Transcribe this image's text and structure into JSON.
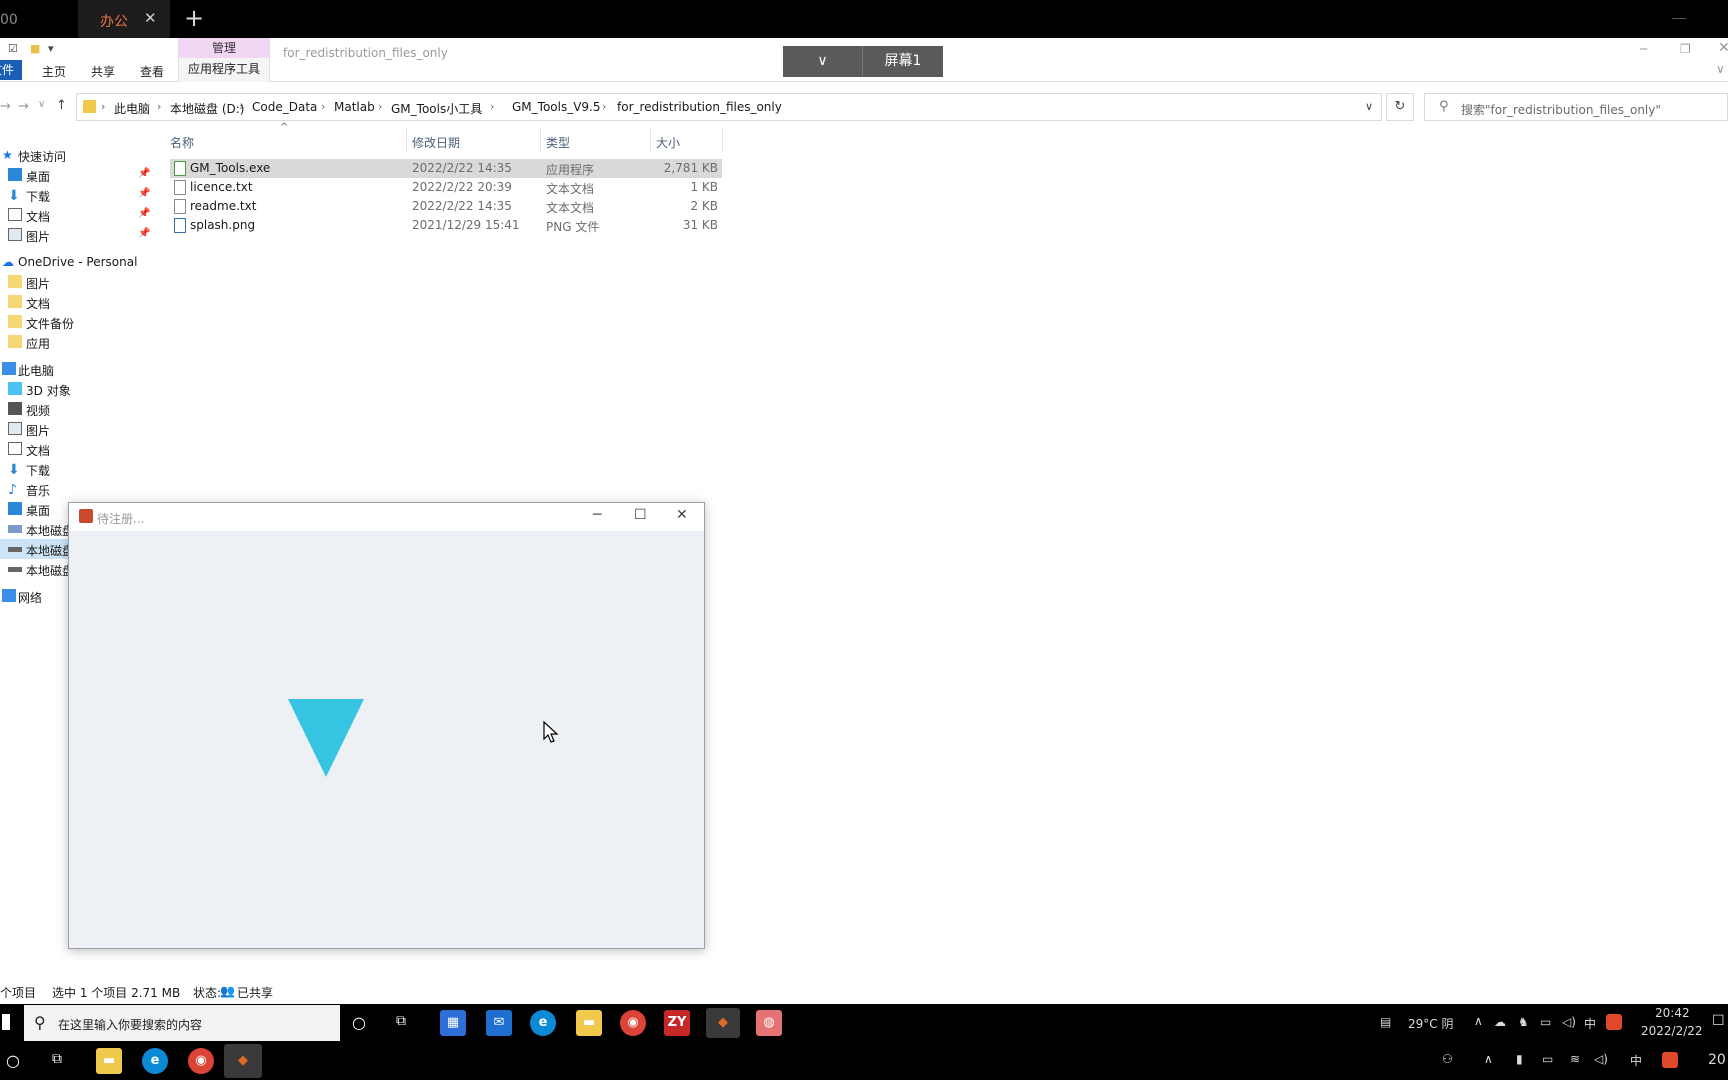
{
  "browser_tabs": {
    "first_tab_label": "00",
    "second_tab_label": "办公",
    "close_symbol": "✕",
    "new_tab_symbol": "+"
  },
  "ribbon": {
    "file_tab": "文件",
    "tabs": [
      "主页",
      "共享",
      "查看"
    ],
    "manage_header": "管理",
    "manage_sub": "应用程序工具",
    "window_title": "for_redistribution_files_only"
  },
  "screen_switch": {
    "chevron": "∨",
    "label": "屏幕1"
  },
  "address": {
    "crumbs": [
      "此电脑",
      "本地磁盘 (D:)",
      "Code_Data",
      "Matlab",
      "GM_Tools小工具",
      "GM_Tools_V9.5",
      "for_redistribution_files_only"
    ],
    "search_placeholder": "搜索\"for_redistribution_files_only\""
  },
  "nav_pane": {
    "quick_access": "快速访问",
    "quick_items": [
      "桌面",
      "下载",
      "文档",
      "图片"
    ],
    "onedrive": "OneDrive - Personal",
    "onedrive_items": [
      "图片",
      "文档",
      "文件备份",
      "应用"
    ],
    "this_pc": "此电脑",
    "pc_items": [
      "3D 对象",
      "视频",
      "图片",
      "文档",
      "下载",
      "音乐",
      "桌面",
      "本地磁盘",
      "本地磁盘",
      "本地磁盘"
    ],
    "network": "网络"
  },
  "file_list": {
    "columns": [
      "名称",
      "修改日期",
      "类型",
      "大小"
    ],
    "rows": [
      {
        "name": "GM_Tools.exe",
        "date": "2022/2/22 14:35",
        "type": "应用程序",
        "size": "2,781 KB"
      },
      {
        "name": "licence.txt",
        "date": "2022/2/22 20:39",
        "type": "文本文档",
        "size": "1 KB"
      },
      {
        "name": "readme.txt",
        "date": "2022/2/22 14:35",
        "type": "文本文档",
        "size": "2 KB"
      },
      {
        "name": "splash.png",
        "date": "2021/12/29 15:41",
        "type": "PNG 文件",
        "size": "31 KB"
      }
    ]
  },
  "status_bar": {
    "items_count": "个项目",
    "selection": "选中 1 个项目  2.71 MB",
    "state": "状态:",
    "shared": "已共享"
  },
  "dialog": {
    "title": "待注册..."
  },
  "taskbar": {
    "search_placeholder": "在这里输入你要搜索的内容",
    "weather": "29°C 阴",
    "ime": "中",
    "time": "20:42",
    "date": "2022/2/22",
    "zy_label": "ZY",
    "bottom_ime": "中",
    "bottom_time": "20"
  },
  "colors": {
    "accent": "#1a5fb4",
    "manage_tab": "#f3d6f3",
    "triangle": "#35c5e2",
    "tab_active_text": "#e8734a"
  }
}
